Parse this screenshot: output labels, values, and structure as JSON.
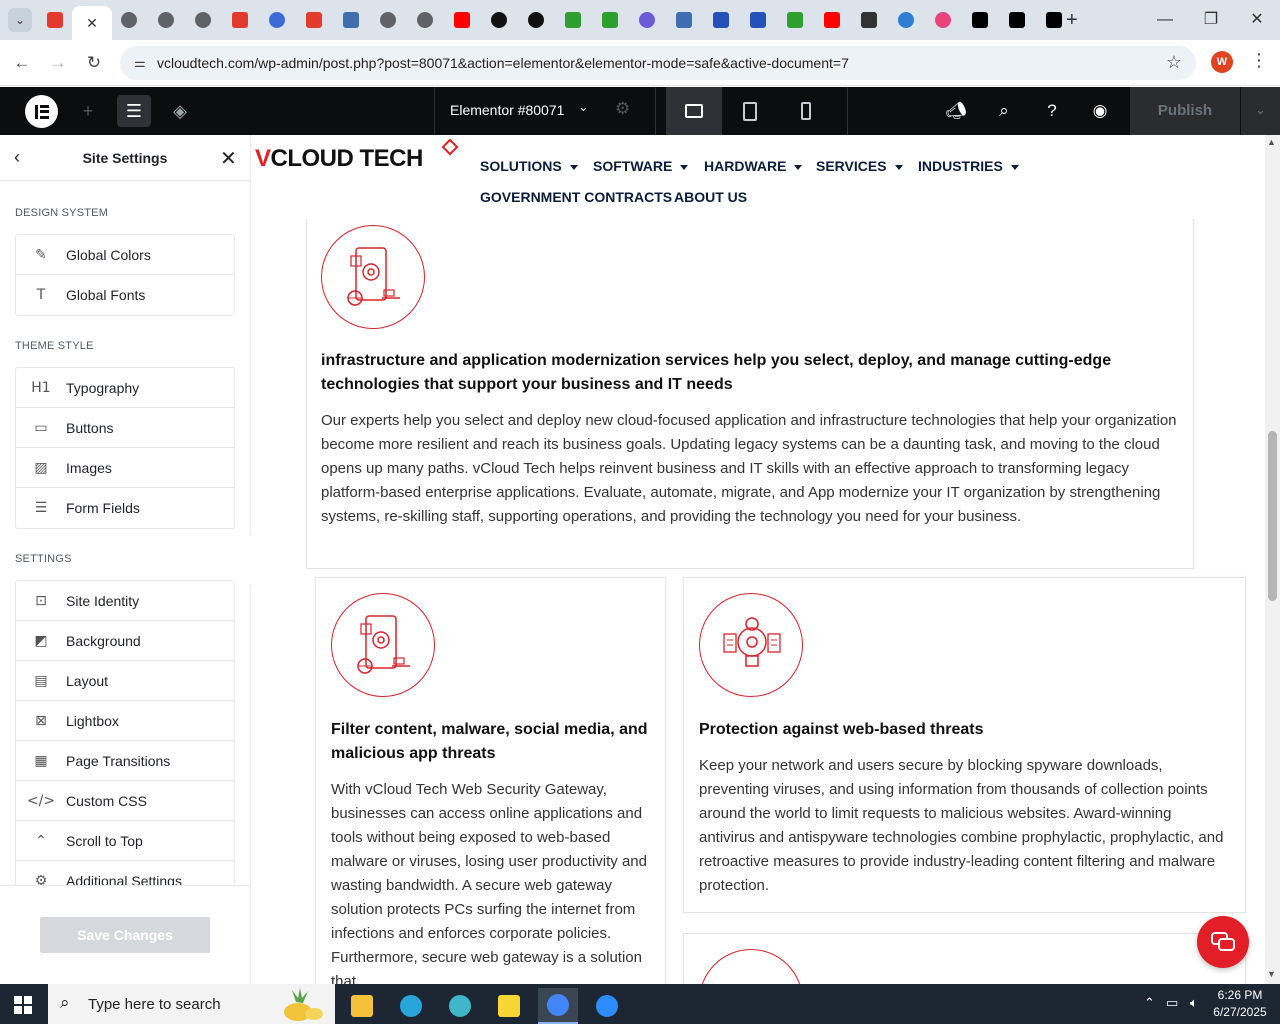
{
  "browser": {
    "url": "vcloudtech.com/wp-admin/post.php?post=80071&action=elementor&elementor-mode=safe&active-document=7",
    "tabs": [
      {
        "color": "#e23b2e",
        "shape": "square"
      },
      {
        "color": "#ffffff",
        "shape": "active"
      },
      {
        "color": "#5f6368",
        "shape": "circle"
      },
      {
        "color": "#5f6368",
        "shape": "circle"
      },
      {
        "color": "#5f6368",
        "shape": "circle"
      },
      {
        "color": "#e23b2e",
        "shape": "square"
      },
      {
        "color": "#3c6bd8",
        "shape": "circle"
      },
      {
        "color": "#e23b2e",
        "shape": "square"
      },
      {
        "color": "#3f6db0",
        "shape": "square"
      },
      {
        "color": "#5f6368",
        "shape": "circle"
      },
      {
        "color": "#5f6368",
        "shape": "circle"
      },
      {
        "color": "#ff0000",
        "shape": "square"
      },
      {
        "color": "#111111",
        "shape": "circle"
      },
      {
        "color": "#111111",
        "shape": "circle"
      },
      {
        "color": "#2e9e2e",
        "shape": "square"
      },
      {
        "color": "#2e9e2e",
        "shape": "square"
      },
      {
        "color": "#6b5bd6",
        "shape": "circle"
      },
      {
        "color": "#3f6db0",
        "shape": "square"
      },
      {
        "color": "#2452b8",
        "shape": "square"
      },
      {
        "color": "#2452b8",
        "shape": "square"
      },
      {
        "color": "#2e9e2e",
        "shape": "square"
      },
      {
        "color": "#ff0000",
        "shape": "square"
      },
      {
        "color": "#333333",
        "shape": "square"
      },
      {
        "color": "#2f7dd1",
        "shape": "circle"
      },
      {
        "color": "#e8457a",
        "shape": "circle"
      },
      {
        "color": "#000000",
        "shape": "square"
      },
      {
        "color": "#000000",
        "shape": "square"
      },
      {
        "color": "#000000",
        "shape": "square"
      }
    ],
    "profile_initial": "W"
  },
  "elementor": {
    "document_title": "Elementor #80071",
    "publish_label": "Publish"
  },
  "panel": {
    "title": "Site Settings",
    "design_system_label": "DESIGN SYSTEM",
    "design_system": [
      {
        "label": "Global Colors",
        "icon": "brush-icon",
        "glyph": "✎"
      },
      {
        "label": "Global Fonts",
        "icon": "font-icon",
        "glyph": "T"
      }
    ],
    "theme_style_label": "THEME STYLE",
    "theme_style": [
      {
        "label": "Typography",
        "icon": "heading-icon",
        "glyph": "H1"
      },
      {
        "label": "Buttons",
        "icon": "button-icon",
        "glyph": "▭"
      },
      {
        "label": "Images",
        "icon": "image-icon",
        "glyph": "▨"
      },
      {
        "label": "Form Fields",
        "icon": "form-icon",
        "glyph": "☰"
      }
    ],
    "settings_label": "SETTINGS",
    "settings": [
      {
        "label": "Site Identity",
        "icon": "site-identity-icon",
        "glyph": "⊡"
      },
      {
        "label": "Background",
        "icon": "background-icon",
        "glyph": "◩"
      },
      {
        "label": "Layout",
        "icon": "layout-icon",
        "glyph": "▤"
      },
      {
        "label": "Lightbox",
        "icon": "lightbox-icon",
        "glyph": "⊠"
      },
      {
        "label": "Page Transitions",
        "icon": "page-transitions-icon",
        "glyph": "▦"
      },
      {
        "label": "Custom CSS",
        "icon": "custom-css-icon",
        "glyph": "</>"
      },
      {
        "label": "Scroll to Top",
        "icon": "scroll-top-icon",
        "glyph": "⌃"
      },
      {
        "label": "Additional Settings",
        "icon": "settings-icon",
        "glyph": "⚙"
      }
    ],
    "save_label": "Save Changes"
  },
  "site": {
    "logo_v": "V",
    "logo_text": "CLOUD TECH",
    "brand_color": "#e21f26",
    "menu": [
      {
        "label": "SOLUTIONS",
        "has_caret": true
      },
      {
        "label": "SOFTWARE",
        "has_caret": true
      },
      {
        "label": "HARDWARE",
        "has_caret": true
      },
      {
        "label": "SERVICES",
        "has_caret": true
      },
      {
        "label": "INDUSTRIES",
        "has_caret": true
      },
      {
        "label": "GOVERNMENT CONTRACTS",
        "has_caret": false
      },
      {
        "label": "ABOUT US",
        "has_caret": false
      }
    ],
    "cards": [
      {
        "title": "infrastructure and application modernization services help you select, deploy, and manage cutting-edge technologies that support your business and IT needs",
        "body": "Our experts help you select and deploy new cloud-focused application and infrastructure technologies that help your organization become more resilient and reach its business goals. Updating legacy systems can be a daunting task, and moving to the cloud opens up many paths. vCloud Tech helps reinvent business and IT skills with an effective approach to transforming legacy platform-based enterprise applications. Evaluate, automate, migrate, and App modernize your IT organization by strengthening systems, re-skilling staff, supporting operations, and providing the technology you need for your business."
      },
      {
        "title": "Filter content, malware, social media, and malicious app threats",
        "body": "With vCloud Tech Web Security Gateway, businesses can access online applications and tools without being exposed to web-based malware or viruses, losing user productivity and wasting bandwidth. A secure web gateway solution protects PCs surfing the internet from infections and enforces corporate policies. Furthermore, secure web gateway is a solution that"
      },
      {
        "title": "Protection against web-based threats",
        "body": "Keep your network and users secure by blocking spyware downloads, preventing viruses, and using information from thousands of collection points around the world to limit requests to malicious websites. Award-winning antivirus and antispyware technologies combine prophylactic, prophylactic, and retroactive measures to provide industry-leading content filtering and malware protection."
      }
    ]
  },
  "taskbar": {
    "search_placeholder": "Type here to search",
    "time": "6:26 PM",
    "date": "6/27/2025",
    "apps": [
      {
        "name": "file-explorer-icon",
        "color": "#f3c13a"
      },
      {
        "name": "edge-icon",
        "color": "#2aa5d9"
      },
      {
        "name": "app-icon",
        "color": "#3fb6c9"
      },
      {
        "name": "sticky-notes-icon",
        "color": "#f7d633"
      },
      {
        "name": "chrome-icon",
        "color": "#4285f4"
      },
      {
        "name": "zoom-icon",
        "color": "#2d8cff"
      }
    ]
  }
}
